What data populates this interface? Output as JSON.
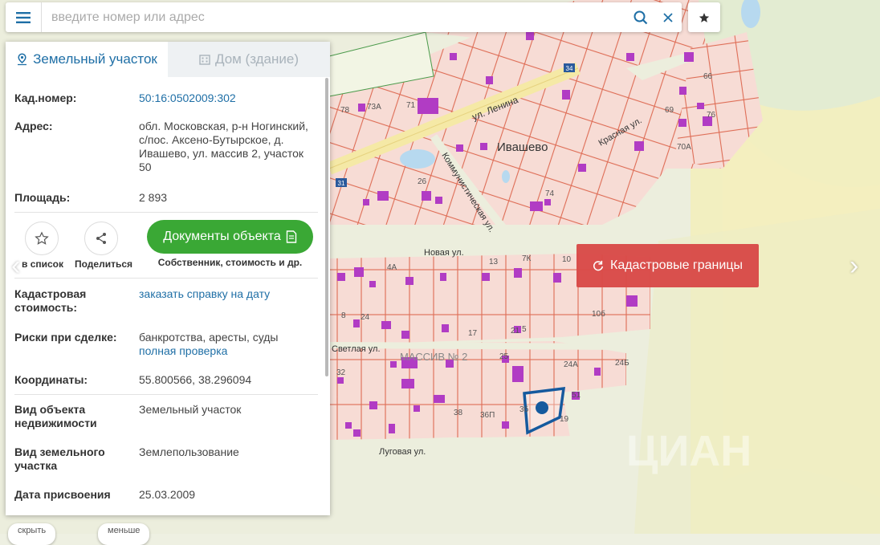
{
  "search": {
    "placeholder": "введите номер или адрес"
  },
  "icons": {
    "menu": "hamburger-icon",
    "search": "search-icon",
    "clear": "close-icon",
    "favorite": "star-icon"
  },
  "tabs": [
    {
      "label": "Земельный участок",
      "icon": "map-pin-icon",
      "active": true
    },
    {
      "label": "Дом (здание)",
      "icon": "building-icon",
      "active": false
    }
  ],
  "info": {
    "cad_number": {
      "label": "Кад.номер:",
      "value": "50:16:0502009:302"
    },
    "address": {
      "label": "Адрес:",
      "value": "обл. Московская, р-н Ногинский, с/пос. Аксено-Бутырское, д. Ивашево, ул. массив 2, участок 50"
    },
    "area": {
      "label": "Площадь:",
      "value": "2 893"
    },
    "cad_cost": {
      "label_line1": "Кадастровая",
      "label_line2": "стоимость:",
      "value": "заказать справку на дату"
    },
    "risks": {
      "label": "Риски при сделке:",
      "value": "банкротства, аресты, суды",
      "link": "полная проверка"
    },
    "coords": {
      "label": "Координаты:",
      "value": "55.800566, 38.296094"
    },
    "object_type": {
      "label_line1": "Вид объекта",
      "label_line2": "недвижимости",
      "value": "Земельный участок"
    },
    "land_type": {
      "label_line1": "Вид земельного",
      "label_line2": "участка",
      "value": "Землепользование"
    },
    "date": {
      "label": "Дата присвоения",
      "value": "25.03.2009"
    }
  },
  "actions": {
    "to_list": "в список",
    "share": "Поделиться",
    "documents": "Документы объекта",
    "documents_sub": "Собственник, стоимость и др."
  },
  "map": {
    "cad_button": "Кадастровые границы",
    "labels": {
      "lenina": "ул. Ленина",
      "village": "Ивашево",
      "krasnaya": "Красная ул.",
      "kommunisticheskaya": "Коммунистическая ул.",
      "novaya": "Новая ул.",
      "svetlaya": "Светлая ул.",
      "massiv": "МАССИВ № 2",
      "lugovaya": "Луговая ул.",
      "watermark": "ЦИАН",
      "road_31": "31",
      "road_34": "34"
    },
    "lot_numbers": [
      "78",
      "73А",
      "71",
      "26",
      "69",
      "70А",
      "74",
      "76",
      "66",
      "4А",
      "13",
      "7К",
      "10",
      "8",
      "24",
      "17",
      "21",
      "5",
      "25",
      "24А",
      "24Б",
      "32",
      "38",
      "36П",
      "3б",
      "19",
      "51",
      "10б"
    ]
  },
  "bottom": {
    "left": "скрыть",
    "right": "меньше"
  },
  "colors": {
    "accent": "#1f6fa6",
    "docs_green": "#3aa835",
    "cad_red": "#d94a48",
    "parcel_border": "#d9634a",
    "parcel_fill": "#f6d7d1",
    "building": "#b13cc4",
    "selected": "#155a9e"
  }
}
